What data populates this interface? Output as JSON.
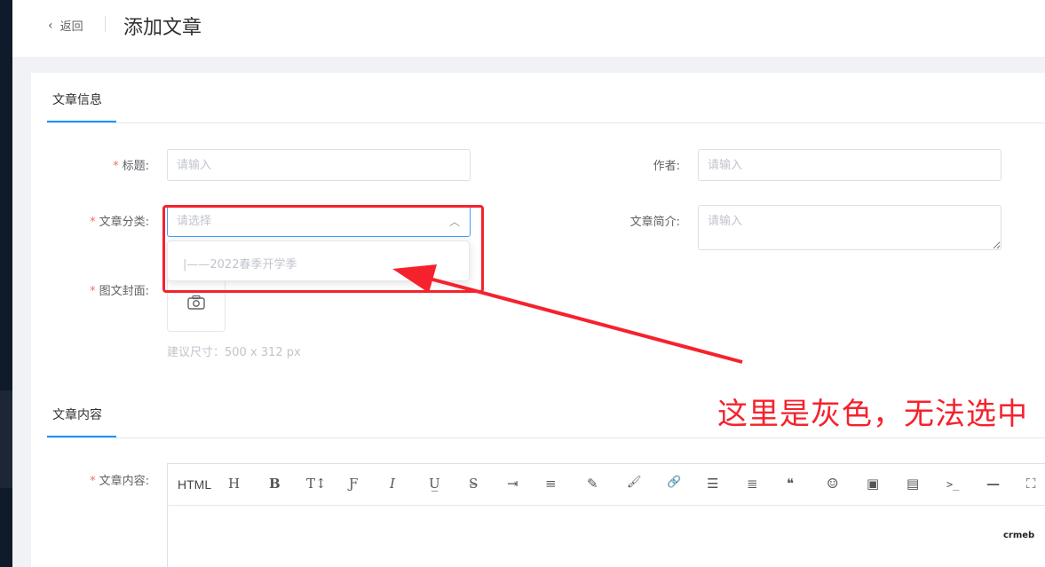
{
  "header": {
    "back_label": "返回",
    "title": "添加文章"
  },
  "sections": {
    "info_tab": "文章信息",
    "content_tab": "文章内容"
  },
  "form": {
    "title_label": "标题:",
    "title_placeholder": "请输入",
    "author_label": "作者:",
    "author_placeholder": "请输入",
    "category_label": "文章分类:",
    "category_placeholder": "请选择",
    "summary_label": "文章简介:",
    "summary_placeholder": "请输入",
    "cover_label": "图文封面:",
    "cover_hint": "建议尺寸：500 x 312 px",
    "content_label": "文章内容:"
  },
  "dropdown": {
    "options": [
      "|——2022春季开学季"
    ]
  },
  "annotation": {
    "text": "这里是灰色，无法选中",
    "color": "#f5222d"
  },
  "editor": {
    "toolbar": [
      {
        "icon": "html-icon",
        "text": "HTML"
      },
      {
        "icon": "heading-icon",
        "text": "H"
      },
      {
        "icon": "bold-icon",
        "text": "B"
      },
      {
        "icon": "font-size-icon",
        "text": "T↕"
      },
      {
        "icon": "font-family-icon",
        "text": "Ƒ"
      },
      {
        "icon": "italic-icon",
        "text": "I"
      },
      {
        "icon": "underline-icon",
        "text": "U̲"
      },
      {
        "icon": "strikethrough-icon",
        "text": "S̶"
      },
      {
        "icon": "indent-icon",
        "text": "⇥"
      },
      {
        "icon": "line-height-icon",
        "text": "≡"
      },
      {
        "icon": "text-color-icon",
        "text": "✎"
      },
      {
        "icon": "bg-color-icon",
        "text": "🖌"
      },
      {
        "icon": "link-icon",
        "text": "🔗"
      },
      {
        "icon": "list-icon",
        "text": "☰"
      },
      {
        "icon": "align-icon",
        "text": "≣"
      },
      {
        "icon": "quote-icon",
        "text": "❝"
      },
      {
        "icon": "emoji-icon",
        "text": "☺"
      },
      {
        "icon": "image-icon",
        "text": "▣"
      },
      {
        "icon": "video-icon",
        "text": "▤"
      },
      {
        "icon": "code-icon",
        "text": ">_"
      },
      {
        "icon": "divider-icon",
        "text": "—"
      },
      {
        "icon": "fullscreen-icon",
        "text": "⛶"
      }
    ]
  },
  "watermark": "crmeb",
  "colors": {
    "accent": "#1890ff",
    "required": "#f56c6c",
    "annotation_red": "#f5222d",
    "sidebar": "#0f1a2b"
  }
}
